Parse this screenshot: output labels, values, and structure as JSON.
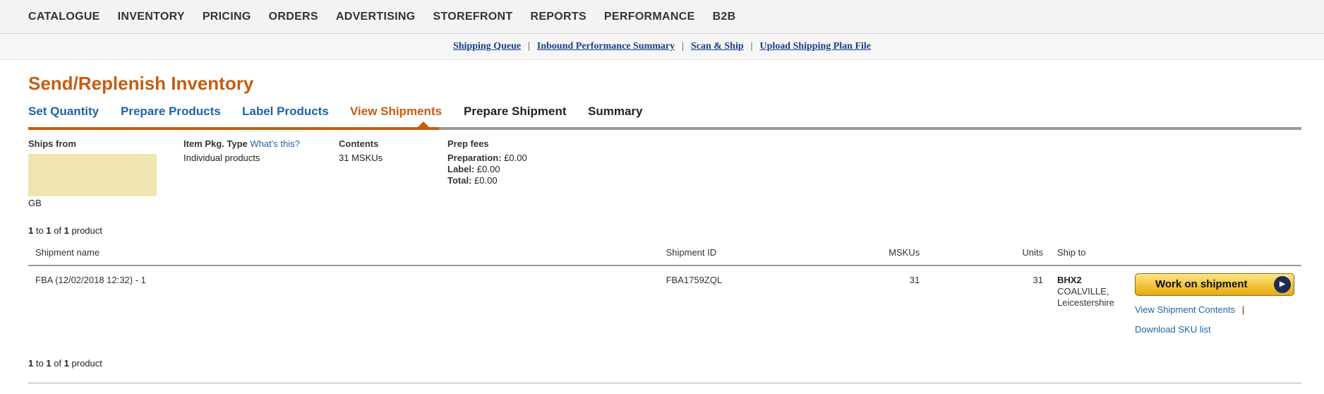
{
  "topnav": {
    "items": [
      "CATALOGUE",
      "INVENTORY",
      "PRICING",
      "ORDERS",
      "ADVERTISING",
      "STOREFRONT",
      "REPORTS",
      "PERFORMANCE",
      "B2B"
    ]
  },
  "sublinks": {
    "items": [
      "Shipping Queue",
      "Inbound Performance Summary",
      "Scan & Ship",
      "Upload Shipping Plan File"
    ],
    "separator": "|"
  },
  "page": {
    "title": "Send/Replenish Inventory"
  },
  "steps": [
    {
      "label": "Set Quantity",
      "state": "done"
    },
    {
      "label": "Prepare Products",
      "state": "done"
    },
    {
      "label": "Label Products",
      "state": "done"
    },
    {
      "label": "View Shipments",
      "state": "current"
    },
    {
      "label": "Prepare Shipment",
      "state": "future"
    },
    {
      "label": "Summary",
      "state": "future"
    }
  ],
  "info": {
    "ships_from_label": "Ships from",
    "ships_from_country": "GB",
    "pkg_type_label": "Item Pkg. Type",
    "whats_this": "What's this?",
    "pkg_type_value": "Individual products",
    "contents_label": "Contents",
    "contents_value": "31 MSKUs",
    "prep_fees_label": "Prep fees",
    "preparation_label": "Preparation:",
    "preparation_value": "£0.00",
    "label_label": "Label:",
    "label_value": "£0.00",
    "total_label": "Total:",
    "total_value": "£0.00"
  },
  "pagination": {
    "from": "1",
    "to_word": "to",
    "to": "1",
    "of_word": "of",
    "total": "1",
    "unit": "product"
  },
  "table": {
    "headers": {
      "name": "Shipment name",
      "id": "Shipment ID",
      "mskus": "MSKUs",
      "units": "Units",
      "ship_to": "Ship to"
    },
    "rows": [
      {
        "name": "FBA (12/02/2018 12:32) - 1",
        "id": "FBA1759ZQL",
        "mskus": "31",
        "units": "31",
        "ship_to_code": "BHX2",
        "ship_to_city": "COALVILLE,",
        "ship_to_region": "Leicestershire",
        "action_button": "Work on shipment",
        "view_contents_link": "View Shipment Contents",
        "link_separator": "|",
        "download_link": "Download SKU list"
      }
    ]
  },
  "colors": {
    "accent_orange": "#c45d12",
    "link_blue": "#1f63a8",
    "sublink_blue": "#1a3e8c",
    "button_yellow": "#f3c33a",
    "address_placeholder": "#f0e5b1"
  }
}
